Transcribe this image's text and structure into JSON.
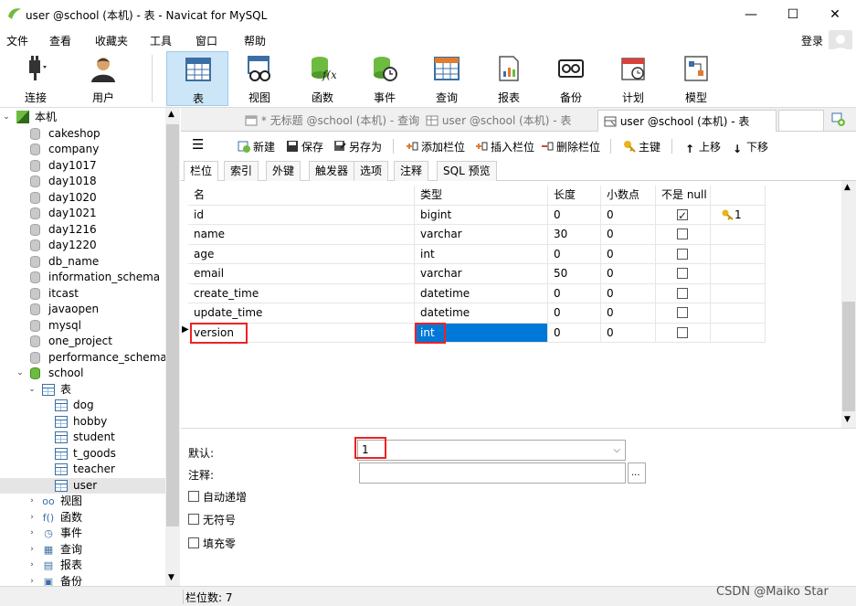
{
  "window": {
    "title": "user @school (本机) - 表 - Navicat for MySQL",
    "minimize": "—",
    "maximize": "☐",
    "close": "✕"
  },
  "menu": [
    "文件",
    "查看",
    "收藏夹",
    "工具",
    "窗口",
    "帮助"
  ],
  "login_label": "登录",
  "toolbar": [
    "连接",
    "用户",
    "表",
    "视图",
    "函数",
    "事件",
    "查询",
    "报表",
    "备份",
    "计划",
    "模型"
  ],
  "tree": {
    "root": "本机",
    "databases": [
      "cakeshop",
      "company",
      "day1017",
      "day1018",
      "day1020",
      "day1021",
      "day1216",
      "day1220",
      "db_name",
      "information_schema",
      "itcast",
      "javaopen",
      "mysql",
      "one_project",
      "performance_schema"
    ],
    "school": "school",
    "tables_node": "表",
    "tables": [
      "dog",
      "hobby",
      "student",
      "t_goods",
      "teacher",
      "user"
    ],
    "other_nodes": [
      "视图",
      "函数",
      "事件",
      "查询",
      "报表",
      "备份"
    ]
  },
  "doc_tabs": [
    "* 无标题 @school (本机) - 查询",
    "user @school (本机) - 表",
    "user @school (本机) - 表"
  ],
  "editor_toolbar": {
    "new": "新建",
    "save": "保存",
    "save_as": "另存为",
    "add_field": "添加栏位",
    "insert_field": "插入栏位",
    "delete_field": "删除栏位",
    "primary_key": "主键",
    "move_up": "上移",
    "move_down": "下移"
  },
  "sub_tabs": [
    "栏位",
    "索引",
    "外键",
    "触发器",
    "选项",
    "注释",
    "SQL 预览"
  ],
  "grid": {
    "headers": [
      "名",
      "类型",
      "长度",
      "小数点",
      "不是 null",
      ""
    ],
    "rows": [
      {
        "name": "id",
        "type": "bigint",
        "length": "0",
        "decimal": "0",
        "not_null": true,
        "key": "1"
      },
      {
        "name": "name",
        "type": "varchar",
        "length": "30",
        "decimal": "0",
        "not_null": false,
        "key": ""
      },
      {
        "name": "age",
        "type": "int",
        "length": "0",
        "decimal": "0",
        "not_null": false,
        "key": ""
      },
      {
        "name": "email",
        "type": "varchar",
        "length": "50",
        "decimal": "0",
        "not_null": false,
        "key": ""
      },
      {
        "name": "create_time",
        "type": "datetime",
        "length": "0",
        "decimal": "0",
        "not_null": false,
        "key": ""
      },
      {
        "name": "update_time",
        "type": "datetime",
        "length": "0",
        "decimal": "0",
        "not_null": false,
        "key": ""
      },
      {
        "name": "version",
        "type": "int",
        "length": "0",
        "decimal": "0",
        "not_null": false,
        "key": ""
      }
    ],
    "row_marker": "▶"
  },
  "properties": {
    "default_label": "默认:",
    "default_value": "1",
    "comment_label": "注释:",
    "comment_btn": "...",
    "auto_increment": "自动递增",
    "unsigned": "无符号",
    "zerofill": "填充零"
  },
  "status": {
    "field_count": "栏位数: 7",
    "watermark": "CSDN @Maiko Star"
  },
  "colors": {
    "accent": "#cde6f7",
    "selection": "#0078d7",
    "highlight_box": "#e22222"
  }
}
